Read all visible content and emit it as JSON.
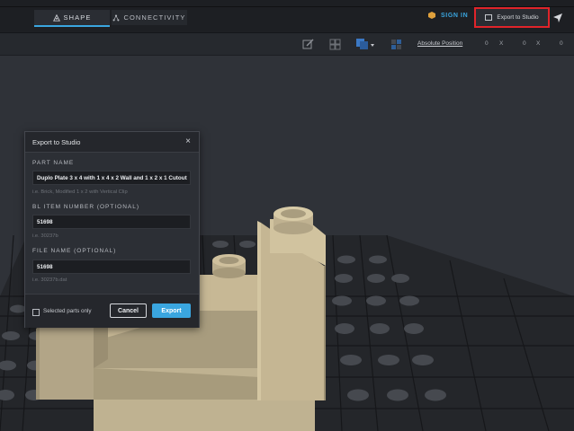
{
  "header": {
    "tabs": [
      {
        "label": "SHAPE",
        "active": true,
        "icon": "shape-icon"
      },
      {
        "label": "CONNECTIVITY",
        "active": false,
        "icon": "connectivity-icon"
      }
    ],
    "signin_label": "SIGN IN",
    "export_label": "Export to Studio",
    "accent_color": "#3aa6e0",
    "highlight_color": "#e0242a"
  },
  "toolbar": {
    "abs_position_label": "Absolute Position",
    "x_value": "0",
    "y_value": "0",
    "z_value": "0",
    "x_label": "X",
    "y_label": "X",
    "icons": [
      "edit-icon",
      "grid-icon",
      "color-swatch-icon",
      "snap-icon"
    ]
  },
  "dialog": {
    "title": "Export to Studio",
    "close_glyph": "×",
    "part_name_label": "PART NAME",
    "part_name_value": "Duplo Plate 3 x 4 with 1 x 4 x 2 Wall and 1 x 2 x 1 Cutout",
    "part_name_hint": "i.e. Brick, Modified 1 x 2 with Vertical Clip",
    "bl_item_label": "BL ITEM NUMBER (OPTIONAL)",
    "bl_item_value": "51698",
    "bl_item_hint": "i.e. 30237b",
    "file_name_label": "FILE NAME (OPTIONAL)",
    "file_name_value": "51698",
    "file_name_hint": "i.e. 30237b.dat",
    "selected_only_label": "Selected parts only",
    "cancel_label": "Cancel",
    "export_label": "Export"
  }
}
